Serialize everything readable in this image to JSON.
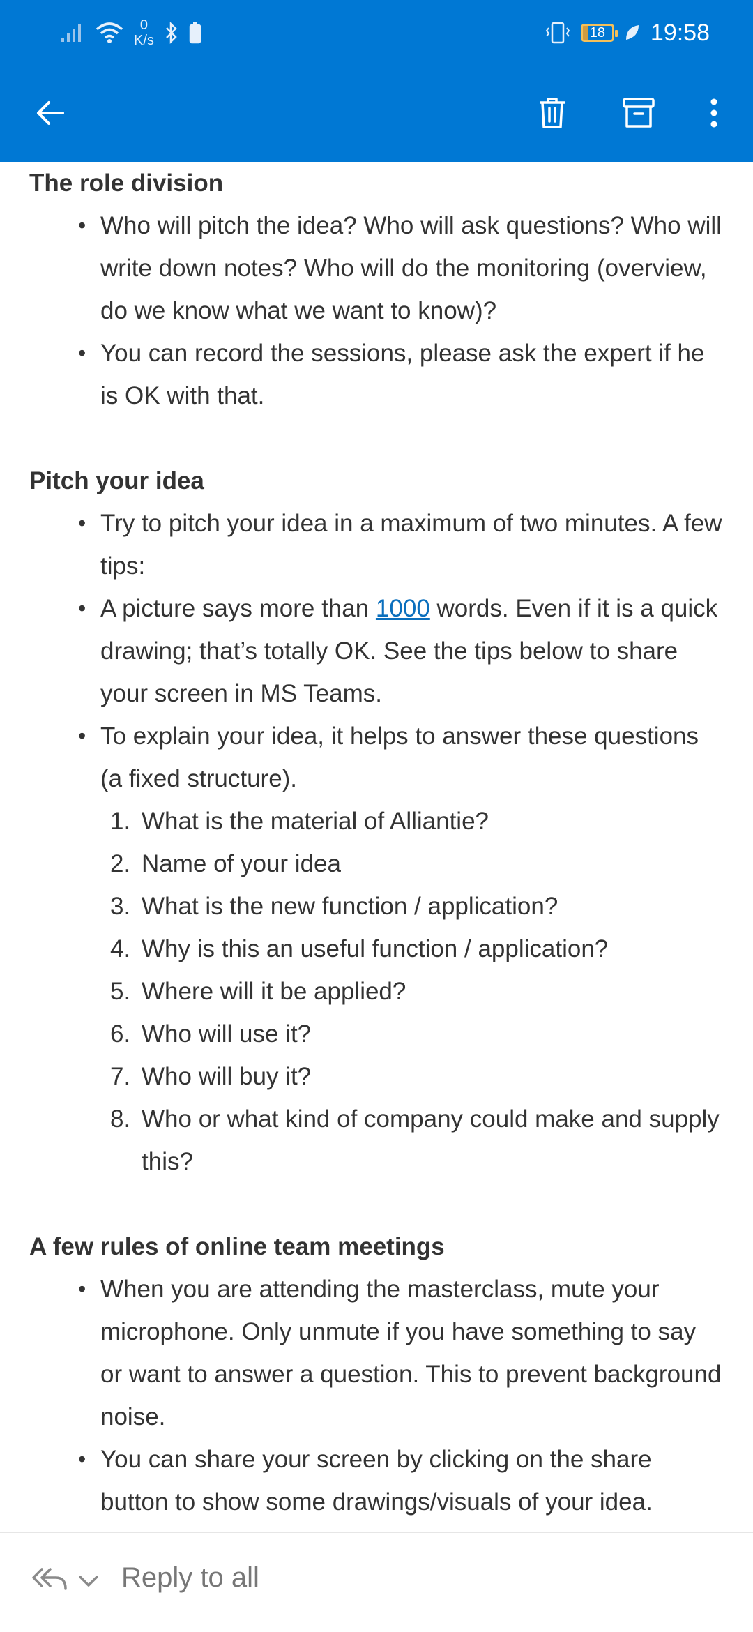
{
  "status_bar": {
    "net_speed_value": "0",
    "net_speed_unit": "K/s",
    "battery_level": "18",
    "time": "19:58"
  },
  "toolbar": {
    "back_icon": "arrow-left-icon",
    "delete_icon": "trash-icon",
    "archive_icon": "archive-icon",
    "more_icon": "more-vertical-icon",
    "accent_color": "#0078d4"
  },
  "email": {
    "sections": [
      {
        "heading": "The role division",
        "bullets": [
          "Who will pitch the idea? Who will ask questions? Who will write down notes? Who will do the monitoring (overview, do we know what we want to know)?",
          "You can record the sessions, please ask the expert if he is OK with that."
        ]
      },
      {
        "heading": "Pitch your idea",
        "bullet_1": "Try to pitch your idea in a maximum of two minutes. A few tips:",
        "bullet_2_pre": "A picture says more than ",
        "bullet_2_link": "1000",
        "bullet_2_post": " words. Even if it is a quick drawing; that’s totally OK. See the tips below to share your screen in MS Teams.",
        "bullet_3": "To explain your idea, it helps to answer these questions (a fixed structure).",
        "questions": [
          {
            "num": "1.",
            "text": "What is the material of Alliantie?"
          },
          {
            "num": "2.",
            "text": "Name of your idea"
          },
          {
            "num": "3.",
            "text": "What is the new function / application?"
          },
          {
            "num": "4.",
            "text": "Why is this an useful function / application?"
          },
          {
            "num": "5.",
            "text": "Where will it be applied?"
          },
          {
            "num": "6.",
            "text": "Who will use it?"
          },
          {
            "num": "7.",
            "text": "Who will buy it?"
          },
          {
            "num": "8.",
            "text": "Who or what kind of company could make and supply this?"
          }
        ]
      },
      {
        "heading": "A few rules of online team meetings",
        "bullets": [
          "When you are attending the masterclass, mute your microphone. Only unmute if you have something to say or want to answer a question. This to prevent background noise.",
          "You can share your screen by clicking on the share button to show some drawings/visuals of your idea."
        ]
      }
    ]
  },
  "reply_bar": {
    "label": "Reply to all",
    "reply_icon": "reply-all-icon",
    "chevron_icon": "chevron-down-icon"
  }
}
